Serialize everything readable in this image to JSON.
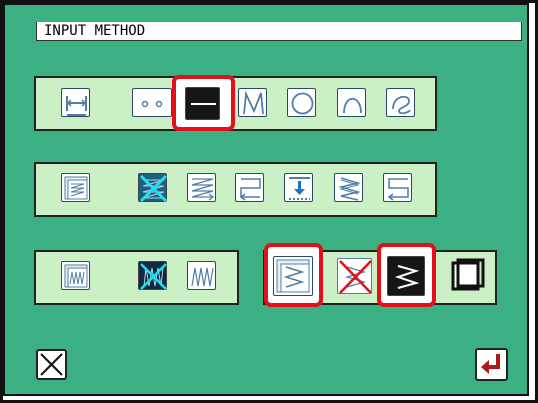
{
  "window": {
    "title": "INPUT METHOD"
  },
  "colors": {
    "background": "#3bb083",
    "panel": "#ccf0c6",
    "highlight": "#e3101a",
    "icon_stroke": "#4f7fa6",
    "selected": "#161616",
    "enter_arrow": "#b01818"
  },
  "rows": {
    "shapes": {
      "items": [
        {
          "icon": "two-point-line-icon",
          "selected": false
        },
        {
          "icon": "point-icon",
          "selected": false
        },
        {
          "icon": "straight-line-icon",
          "selected": true
        },
        {
          "icon": "polyline-icon",
          "selected": false
        },
        {
          "icon": "circle-icon",
          "selected": false
        },
        {
          "icon": "arc-icon",
          "selected": false
        },
        {
          "icon": "curve-icon",
          "selected": false
        }
      ]
    },
    "fill_stitch": {
      "items": [
        {
          "icon": "fill-stitch-pattern-icon",
          "selected": false
        },
        {
          "icon": "fill-disabled-icon",
          "selected": true
        },
        {
          "icon": "fill-arrows-icon",
          "selected": false
        },
        {
          "icon": "fill-return-icon",
          "selected": false
        },
        {
          "icon": "fill-down-arrow-icon",
          "selected": false
        },
        {
          "icon": "fill-zigzag-icon",
          "selected": false
        },
        {
          "icon": "fill-reverse-icon",
          "selected": false
        }
      ]
    },
    "zigzag": {
      "items": [
        {
          "icon": "zigzag-pattern-icon",
          "selected": false
        },
        {
          "icon": "zigzag-disabled-icon",
          "selected": true
        },
        {
          "icon": "zigzag-icon",
          "selected": false
        }
      ]
    },
    "zigzag_options": {
      "items": [
        {
          "icon": "zigzag-stitch-pattern-icon",
          "selected": true
        },
        {
          "icon": "cross-disabled-icon",
          "selected": false
        },
        {
          "icon": "zigzag-dark-icon",
          "selected": true
        },
        {
          "icon": "frame-icon",
          "selected": false
        }
      ]
    }
  },
  "footer": {
    "cancel_icon": "close-icon",
    "enter_icon": "enter-icon"
  }
}
